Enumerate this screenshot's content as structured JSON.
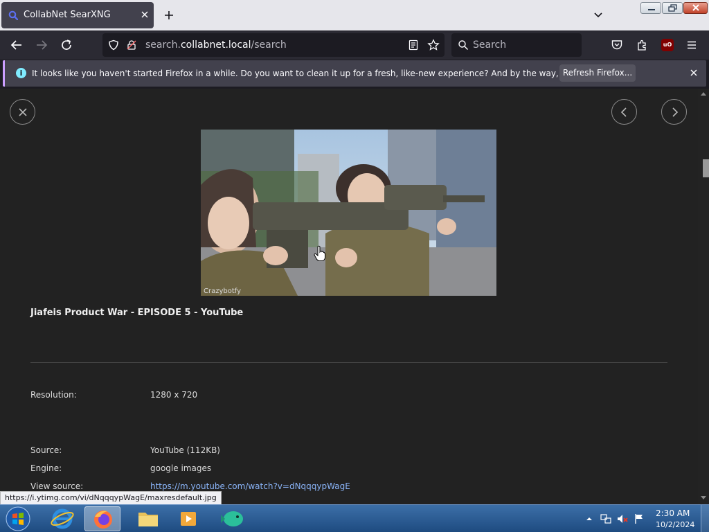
{
  "browser": {
    "tab_title": "CollabNet SearXNG",
    "url_prefix": "search.",
    "url_host": "collabnet.local",
    "url_path": "/search",
    "search_placeholder": "Search",
    "ublock_label": "uO"
  },
  "notification": {
    "message": "It looks like you haven't started Firefox in a while. Do you want to clean it up for a fresh, like-new experience? And by the way, welcome back!",
    "button_label": "Refresh Firefox..."
  },
  "result": {
    "title": "Jiafeis Product War - EPISODE 5 - YouTube",
    "watermark": "Crazybotfy",
    "details": [
      {
        "label": "Resolution:",
        "value": "1280 x 720"
      },
      {
        "label": "Source:",
        "value": "YouTube (112KB)"
      },
      {
        "label": "Engine:",
        "value": "google images"
      },
      {
        "label": "View source:",
        "value": "https://m.youtube.com/watch?v=dNqqqypWagE"
      }
    ]
  },
  "status_bar": {
    "hover_url": "https://i.ytimg.com/vi/dNqqqypWagE/maxresdefault.jpg"
  },
  "taskbar": {
    "time": "2:30 AM",
    "date": "10/2/2024"
  },
  "colors": {
    "accent": "#cb9eff",
    "link": "#8ab4f8",
    "content_bg": "#222222"
  }
}
